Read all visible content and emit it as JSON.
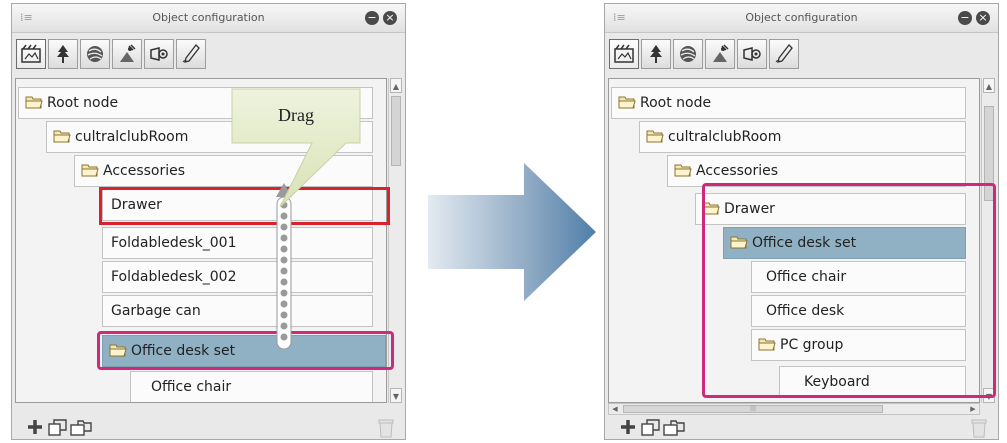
{
  "panels": {
    "before": {
      "title": "Object configuration",
      "tree": [
        {
          "label": "Root node",
          "folder": true
        },
        {
          "label": "cultralclubRoom",
          "folder": true
        },
        {
          "label": "Accessories",
          "folder": true
        },
        {
          "label": "Drawer",
          "folder": false
        },
        {
          "label": "Foldabledesk_001",
          "folder": false
        },
        {
          "label": "Foldabledesk_002",
          "folder": false
        },
        {
          "label": "Garbage can",
          "folder": false
        },
        {
          "label": "Office desk set",
          "folder": true,
          "selected": true
        },
        {
          "label": "Office chair",
          "folder": false
        }
      ]
    },
    "after": {
      "title": "Object configuration",
      "tree": [
        {
          "label": "Root node",
          "folder": true
        },
        {
          "label": "cultralclubRoom",
          "folder": true
        },
        {
          "label": "Accessories",
          "folder": true
        },
        {
          "label": "Drawer",
          "folder": true
        },
        {
          "label": "Office desk set",
          "folder": true,
          "selected": true
        },
        {
          "label": "Office chair",
          "folder": false
        },
        {
          "label": "Office desk",
          "folder": false
        },
        {
          "label": "PC group",
          "folder": true
        },
        {
          "label": "Keyboard",
          "folder": false
        }
      ]
    }
  },
  "callout": {
    "text": "Drag"
  },
  "toolbar_icons": [
    "camera-icon",
    "tree-icon",
    "sphere-icon",
    "light-icon",
    "camera-angle-icon",
    "pen-icon"
  ],
  "bottom_icons": [
    "add-icon",
    "new-folder-icon",
    "folder-group-icon",
    "trash-icon"
  ],
  "colors": {
    "selected_row": "#8fb1c3",
    "drag_highlight": "#d9232c",
    "group_highlight": "#cd2a7c",
    "callout_fill": "#e5eccc",
    "arrow_gradient_start": "#dde6ef",
    "arrow_gradient_end": "#4f7ea8"
  }
}
